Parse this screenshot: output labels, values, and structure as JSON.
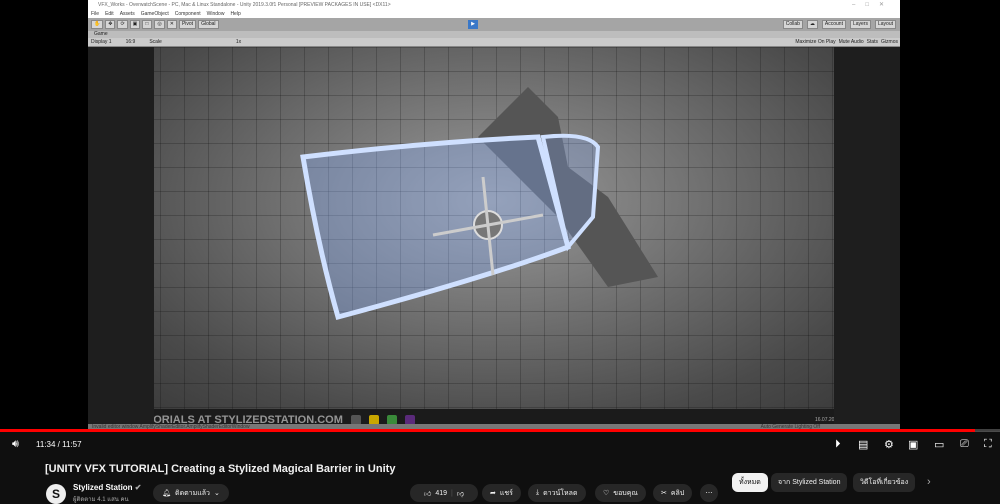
{
  "unity": {
    "title": "VFX_Works - OverwatchScene - PC, Mac & Linux Standalone - Unity 2019.3.0f1 Personal [PREVIEW PACKAGES IN USE] <DX11>",
    "menu": [
      "File",
      "Edit",
      "Assets",
      "GameObject",
      "Component",
      "Window",
      "Help"
    ],
    "pivot": "Pivot",
    "global": "Global",
    "collab": "Collab",
    "account": "Account",
    "layers": "Layers",
    "layout": "Layout",
    "game_tab": "Game",
    "display": "Display 1",
    "aspect": "16:9",
    "scale_label": "Scale",
    "scale_value": "1x",
    "game_opts": [
      "Maximize On Play",
      "Mute Audio",
      "Stats",
      "Gizmos"
    ],
    "status_error": "Invalid editor window AmplifyShaderEditor.AmplifyShaderEditorWindow",
    "status_right": "Auto Generate Lighting Off",
    "watermark": "MORE TUTORIALS AT STYLIZEDSTATION.COM",
    "taskbar_date": "16.07.2020"
  },
  "player": {
    "time": "11:34 / 11:57",
    "progress": 0.975
  },
  "video": {
    "title": "[UNITY VFX TUTORIAL] Creating a Stylized Magical Barrier in Unity",
    "channel": "Stylized Station",
    "subscribers": "ผู้ติดตาม 4.1 แสน คน",
    "subscribe": "ติดตามแล้ว",
    "likes": "419",
    "share": "แชร์",
    "download": "ดาวน์โหลด",
    "thanks": "ขอบคุณ",
    "clip": "คลิป"
  },
  "chips": [
    "ทั้งหมด",
    "จาก Stylized Station",
    "วิดีโอที่เกี่ยวข้อง"
  ],
  "colors": {
    "progress": "#ff0000",
    "bg": "#0f0f0f"
  }
}
